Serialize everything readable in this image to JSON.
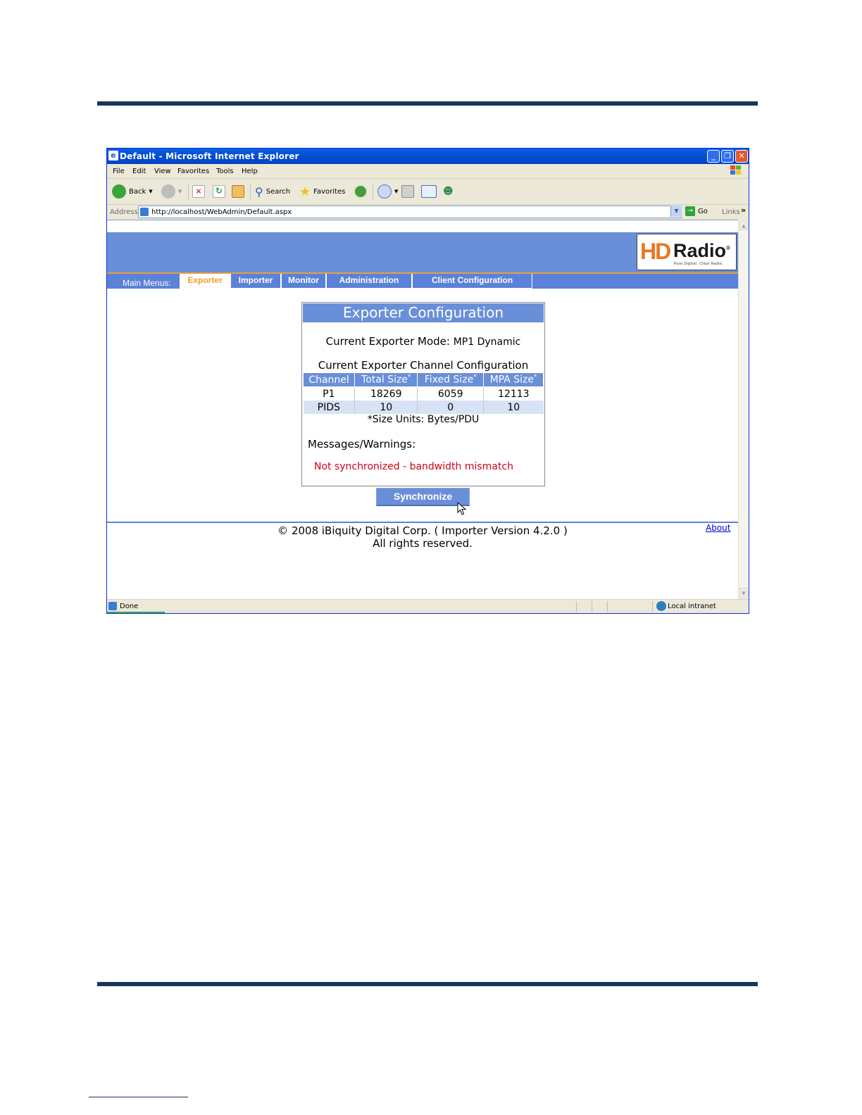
{
  "window": {
    "title": "Default - Microsoft Internet Explorer",
    "minimize_glyph": "_",
    "maximize_glyph": "❐",
    "close_glyph": "✕"
  },
  "menu": [
    "File",
    "Edit",
    "View",
    "Favorites",
    "Tools",
    "Help"
  ],
  "toolbar": {
    "back": "Back",
    "search": "Search",
    "favorites": "Favorites"
  },
  "address": {
    "label": "Address",
    "url": "http://localhost/WebAdmin/Default.aspx",
    "go": "Go",
    "links": "Links"
  },
  "logo": {
    "hd": "HD",
    "radio": "Radio",
    "registered": "®",
    "tagline": "Pure Digital. Clear Radio."
  },
  "nav": {
    "label": "Main Menus:",
    "tabs": [
      "Exporter",
      "Importer",
      "Monitor",
      "Administration",
      "Client Configuration"
    ],
    "active": "Exporter"
  },
  "config": {
    "title": "Exporter Configuration",
    "mode_label": "Current Exporter Mode:",
    "mode_value": "MP1 Dynamic",
    "channel_title": "Current Exporter Channel Configuration",
    "columns": [
      "Channel",
      "Total Size",
      "Fixed Size",
      "MPA Size"
    ],
    "column_marker": "*",
    "rows": [
      [
        "P1",
        "18269",
        "6059",
        "12113"
      ],
      [
        "PIDS",
        "10",
        "0",
        "10"
      ]
    ],
    "units_note": "*Size Units: Bytes/PDU",
    "messages_label": "Messages/Warnings:",
    "message": "Not synchronized - bandwidth mismatch"
  },
  "sync_button": "Synchronize",
  "footer": {
    "copyright": "© 2008 iBiquity Digital Corp. ( Importer Version 4.2.0 )",
    "rights": "All rights reserved.",
    "about": "About"
  },
  "status": {
    "text": "Done",
    "zone": "Local intranet"
  },
  "colors": {
    "banner": "#6a8fd9",
    "active_tab_text": "#f2a21d",
    "warning_text": "#d0021b",
    "doc_rule": "#17365d"
  }
}
